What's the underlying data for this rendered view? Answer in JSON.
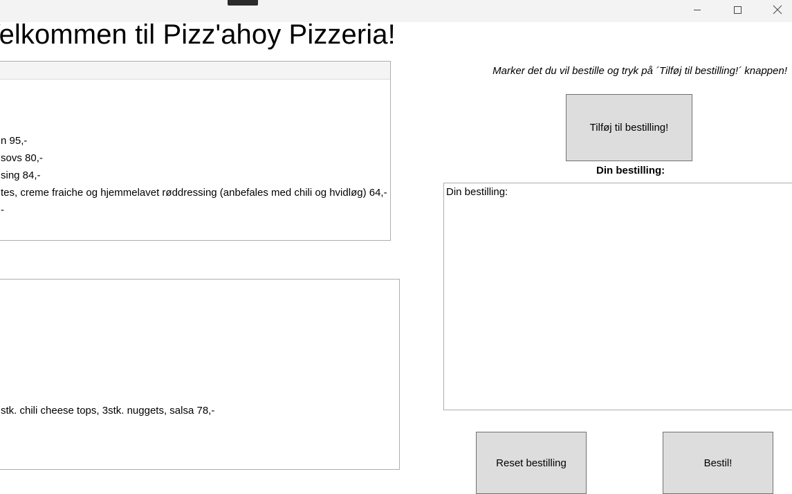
{
  "window": {
    "controls": [
      {
        "name": "minimize",
        "icon": "minimize-icon"
      },
      {
        "name": "maximize",
        "icon": "maximize-icon"
      },
      {
        "name": "close",
        "icon": "close-icon"
      }
    ]
  },
  "header": {
    "welcome_text": "Velkommen til Pizz'ahoy Pizzeria!"
  },
  "menu_pizza": {
    "items": [
      "n 95,-",
      "sovs 80,-",
      "sing 84,-",
      "tes, creme fraiche og hjemmelavet røddressing (anbefales med chili og hvidløg) 64,-",
      "-"
    ]
  },
  "menu_sides": {
    "items": [
      "stk. chili cheese tops, 3stk. nuggets, salsa 78,-"
    ]
  },
  "order": {
    "instruction": "Marker det du vil bestille og tryk på ´Tilføj til bestilling!´ knappen!",
    "add_button": "Tilføj til bestilling!",
    "title": "Din bestilling:",
    "textbox_value": "Din bestilling:",
    "reset_button": "Reset bestilling",
    "order_button": "Bestil!"
  },
  "colors": {
    "titlebar": "#f3f3f3",
    "button_bg": "#dddddd",
    "border": "#adadad"
  }
}
